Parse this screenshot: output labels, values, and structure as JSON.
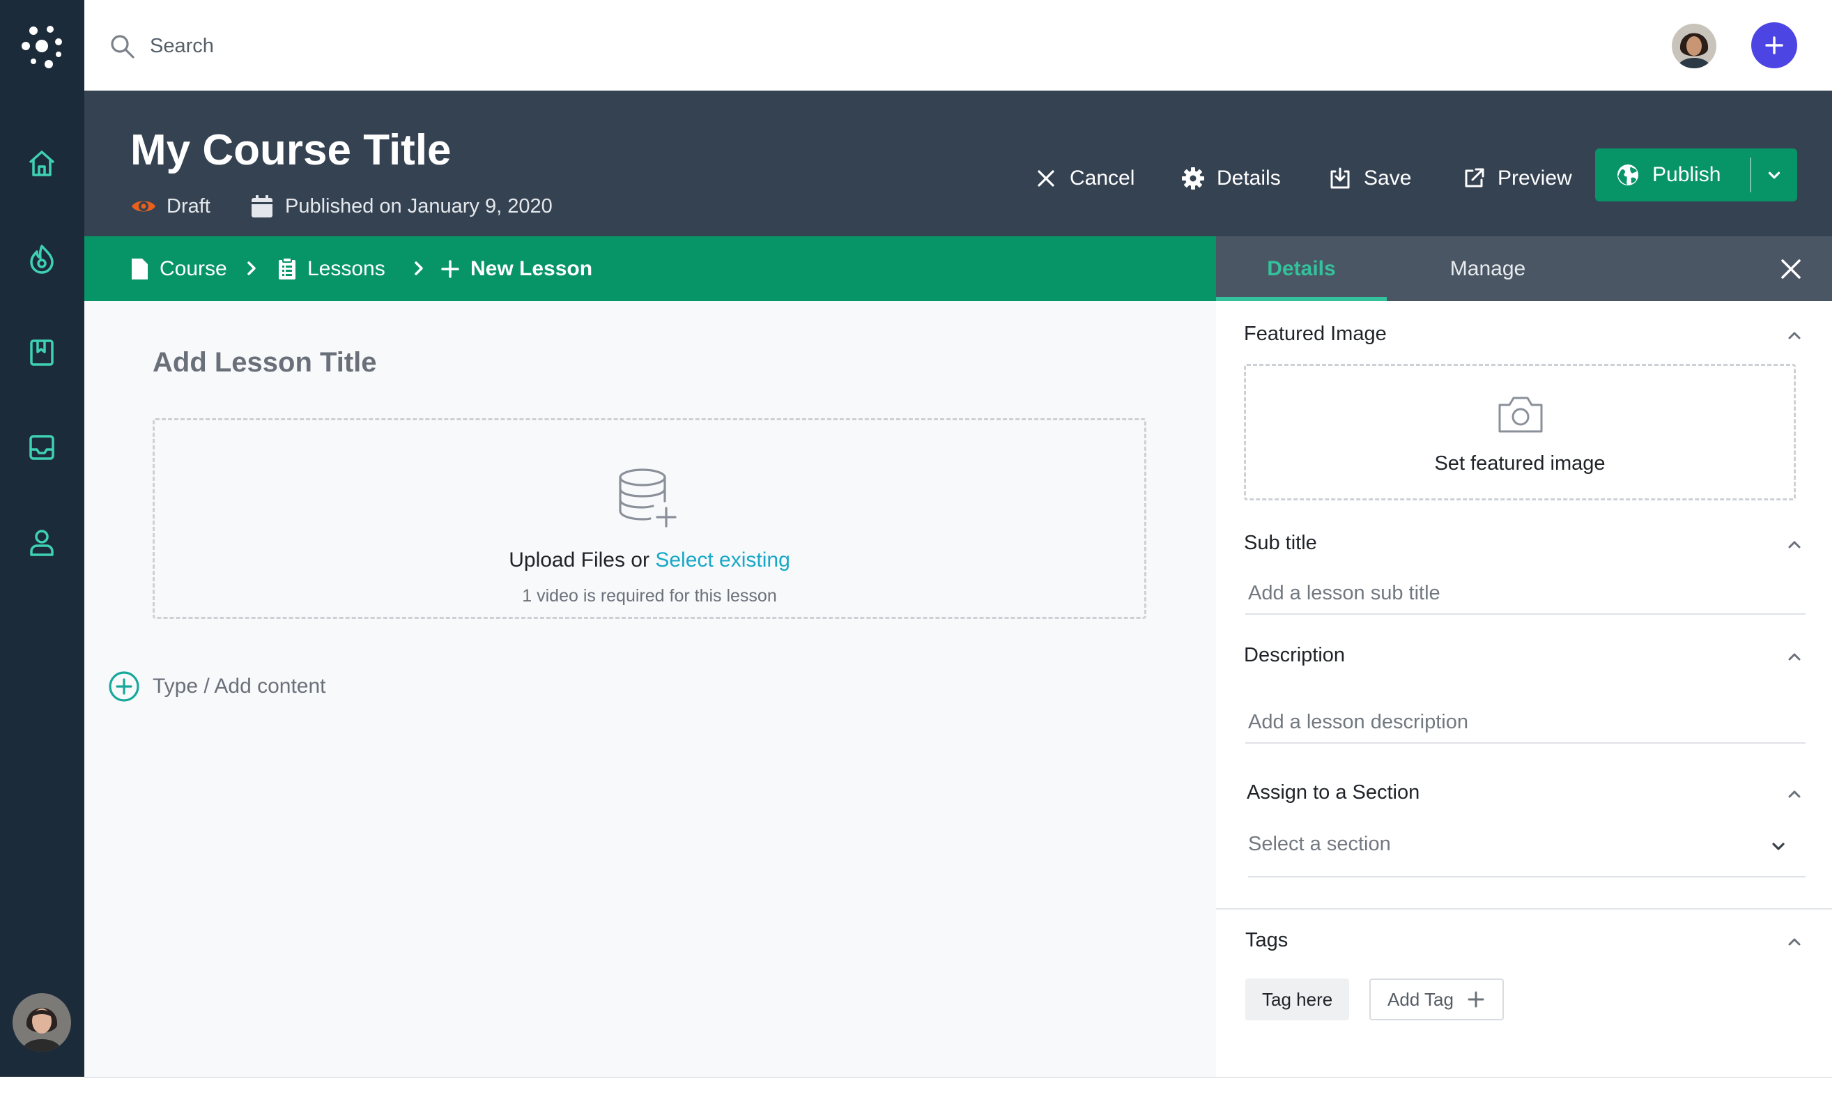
{
  "search": {
    "placeholder": "Search"
  },
  "course": {
    "title": "My Course Title",
    "status": "Draft",
    "published": "Published on January 9, 2020"
  },
  "actions": {
    "cancel": "Cancel",
    "details": "Details",
    "save": "Save",
    "preview": "Preview",
    "publish": "Publish"
  },
  "breadcrumb": {
    "course": "Course",
    "lessons": "Lessons",
    "current": "New Lesson"
  },
  "editor": {
    "title_placeholder": "Add Lesson Title",
    "upload_text": "Upload Files or",
    "select_existing": "Select existing",
    "requirement": "1 video is required for this lesson",
    "add_content": "Type / Add content"
  },
  "panel": {
    "tabs": [
      "Details",
      "Manage"
    ],
    "featured_image": {
      "label": "Featured Image",
      "action": "Set featured image"
    },
    "subtitle": {
      "label": "Sub title",
      "placeholder": "Add a lesson sub title"
    },
    "description": {
      "label": "Description",
      "placeholder": "Add a lesson description"
    },
    "section": {
      "label": "Assign to a Section",
      "placeholder": "Select a section"
    },
    "tags": {
      "label": "Tags",
      "items": [
        "Tag here"
      ],
      "add_label": "Add Tag"
    }
  },
  "nav_icons": [
    "home-icon",
    "fire-icon",
    "book-icon",
    "inbox-icon",
    "user-icon"
  ],
  "colors": {
    "rail": "#1c2b3a",
    "header": "#354252",
    "green": "#079466",
    "accent_teal": "#33c29c",
    "link": "#17a8c6",
    "add_button": "#4c45e3",
    "status_orange": "#e8601c"
  }
}
